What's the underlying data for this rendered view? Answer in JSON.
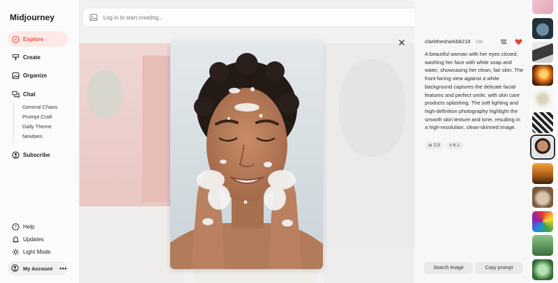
{
  "app": {
    "brand": "Midjourney"
  },
  "nav": {
    "explore": "Explore",
    "create": "Create",
    "organize": "Organize",
    "chat": "Chat",
    "chat_rooms": [
      "General Chaos",
      "Prompt Craft",
      "Daily Theme",
      "Newbies"
    ],
    "subscribe": "Subscribe",
    "help": "Help",
    "updates": "Updates",
    "light_mode": "Light Mode",
    "account": "My Account"
  },
  "search": {
    "placeholder": "Log in to start creating..."
  },
  "detail": {
    "username": "clarkthesharkb8218",
    "time": "23h",
    "liked": true,
    "prompt": "A beautiful woman with her eyes closed, washing her face with white soap and water, showcasing her clean, fair skin. The front-facing view against a white background captures the delicate facial features and perfect smile, with skin care products splashing. The soft lighting and high-definition photography highlight the smooth skin texture and tone, resulting in a high-resolution, clean-skinned image.",
    "params": [
      "ar 2:3",
      "v 6.1"
    ],
    "search_image": "Search Image",
    "copy_prompt": "Copy prompt"
  },
  "colors": {
    "accent": "#e4564a",
    "active_bg": "#fde9e6",
    "heart": "#e0443a"
  },
  "thumbnails": [
    {
      "name": "thumb-pink-figure",
      "selected": false
    },
    {
      "name": "thumb-robot-creature",
      "selected": false
    },
    {
      "name": "thumb-mech-warrior",
      "selected": false
    },
    {
      "name": "thumb-orange-glow",
      "selected": false
    },
    {
      "name": "thumb-flowers",
      "selected": false
    },
    {
      "name": "thumb-black-white-collage",
      "selected": false
    },
    {
      "name": "thumb-woman-face",
      "selected": true
    },
    {
      "name": "thumb-golden-landscape",
      "selected": false
    },
    {
      "name": "thumb-animal-character",
      "selected": false
    },
    {
      "name": "thumb-colorful-art",
      "selected": false
    },
    {
      "name": "thumb-green-scene",
      "selected": false
    },
    {
      "name": "thumb-green-figure",
      "selected": false
    }
  ]
}
